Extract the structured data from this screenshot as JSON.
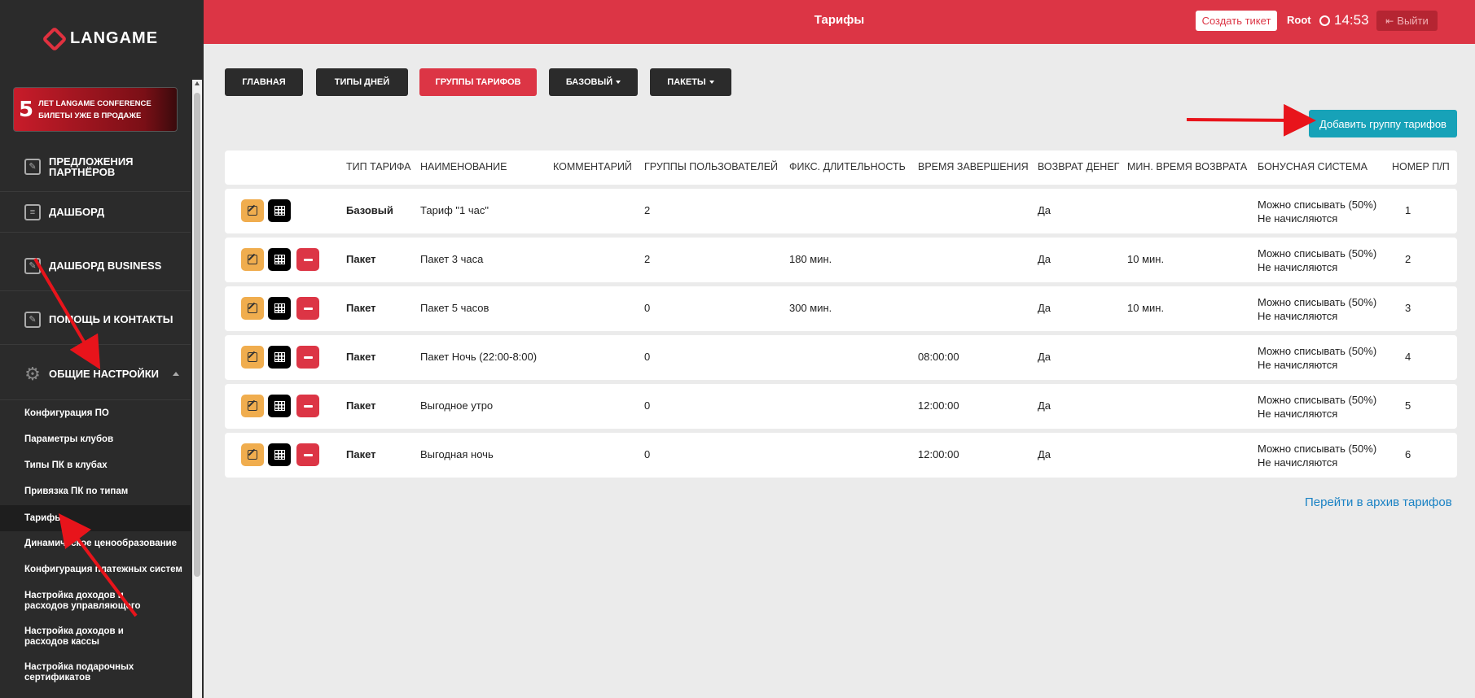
{
  "brand": {
    "logo_text_main": "LAN",
    "logo_text_rest": "GAME"
  },
  "banner": {
    "number": "5",
    "line1": "лет LANGAME CONFERENCE",
    "line2": "Билеты уже в продаже"
  },
  "sidebar": {
    "items": [
      {
        "label": "ПРЕДЛОЖЕНИЯ ПАРТНЁРОВ",
        "icon": "edit-icon"
      },
      {
        "label": "ДАШБОРД",
        "icon": "book-icon"
      },
      {
        "label": "ДАШБОРД BUSINESS",
        "icon": "edit-icon"
      },
      {
        "label": "ПОМОЩЬ И КОНТАКТЫ",
        "icon": "edit-icon"
      },
      {
        "label": "ОБЩИЕ НАСТРОЙКИ",
        "icon": "gear-icon"
      }
    ],
    "subitems": [
      "Конфигурация ПО",
      "Параметры клубов",
      "Типы ПК в клубах",
      "Привязка ПК по типам",
      "Тарифы",
      "Динамическое ценообразование",
      "Конфигурация платежных систем",
      "Настройка доходов и расходов управляющего",
      "Настройка доходов и расходов кассы",
      "Настройка подарочных сертификатов"
    ],
    "active_subitem": "Тарифы"
  },
  "header": {
    "title": "Тарифы",
    "ticket_button": "Создать тикет",
    "user": "Root",
    "time": "14:53",
    "logout": "Выйти"
  },
  "tabs": [
    {
      "label": "ГЛАВНАЯ",
      "active": false,
      "dropdown": false
    },
    {
      "label": "ТИПЫ ДНЕЙ",
      "active": false,
      "dropdown": false
    },
    {
      "label": "ГРУППЫ ТАРИФОВ",
      "active": true,
      "dropdown": false
    },
    {
      "label": "БАЗОВЫЙ",
      "active": false,
      "dropdown": true
    },
    {
      "label": "ПАКЕТЫ",
      "active": false,
      "dropdown": true
    }
  ],
  "add_button": "Добавить группу тарифов",
  "table": {
    "headers": [
      "ТИП ТАРИФА",
      "НАИМЕНОВАНИЕ",
      "КОММЕНТАРИЙ",
      "ГРУППЫ ПОЛЬЗОВАТЕЛЕЙ",
      "ФИКС. ДЛИТЕЛЬНОСТЬ",
      "ВРЕМЯ ЗАВЕРШЕНИЯ",
      "ВОЗВРАТ ДЕНЕГ",
      "МИН. ВРЕМЯ ВОЗВРАТА",
      "БОНУСНАЯ СИСТЕМА",
      "НОМЕР П/П"
    ],
    "rows": [
      {
        "type": "Базовый",
        "name": "Тариф \"1 час\"",
        "comment": "",
        "groups": "2",
        "fixed": "",
        "end_time": "",
        "refund": "Да",
        "min_refund": "",
        "bonus1": "Можно списывать (50%)",
        "bonus2": "Не начисляются",
        "num": "1",
        "deletable": false
      },
      {
        "type": "Пакет",
        "name": "Пакет 3 часа",
        "comment": "",
        "groups": "2",
        "fixed": "180 мин.",
        "end_time": "",
        "refund": "Да",
        "min_refund": "10 мин.",
        "bonus1": "Можно списывать (50%)",
        "bonus2": "Не начисляются",
        "num": "2",
        "deletable": true
      },
      {
        "type": "Пакет",
        "name": "Пакет 5 часов",
        "comment": "",
        "groups": "0",
        "fixed": "300 мин.",
        "end_time": "",
        "refund": "Да",
        "min_refund": "10 мин.",
        "bonus1": "Можно списывать (50%)",
        "bonus2": "Не начисляются",
        "num": "3",
        "deletable": true
      },
      {
        "type": "Пакет",
        "name": "Пакет Ночь (22:00-8:00)",
        "comment": "",
        "groups": "0",
        "fixed": "",
        "end_time": "08:00:00",
        "refund": "Да",
        "min_refund": "",
        "bonus1": "Можно списывать (50%)",
        "bonus2": "Не начисляются",
        "num": "4",
        "deletable": true
      },
      {
        "type": "Пакет",
        "name": "Выгодное утро",
        "comment": "",
        "groups": "0",
        "fixed": "",
        "end_time": "12:00:00",
        "refund": "Да",
        "min_refund": "",
        "bonus1": "Можно списывать (50%)",
        "bonus2": "Не начисляются",
        "num": "5",
        "deletable": true
      },
      {
        "type": "Пакет",
        "name": "Выгодная ночь",
        "comment": "",
        "groups": "0",
        "fixed": "",
        "end_time": "12:00:00",
        "refund": "Да",
        "min_refund": "",
        "bonus1": "Можно списывать (50%)",
        "bonus2": "Не начисляются",
        "num": "6",
        "deletable": true
      }
    ]
  },
  "archive_link": "Перейти в архив тарифов",
  "colors": {
    "accent": "#dc3545",
    "teal": "#17a2b8",
    "sidebar": "#2b2b2b",
    "edit": "#f0ad4e"
  }
}
